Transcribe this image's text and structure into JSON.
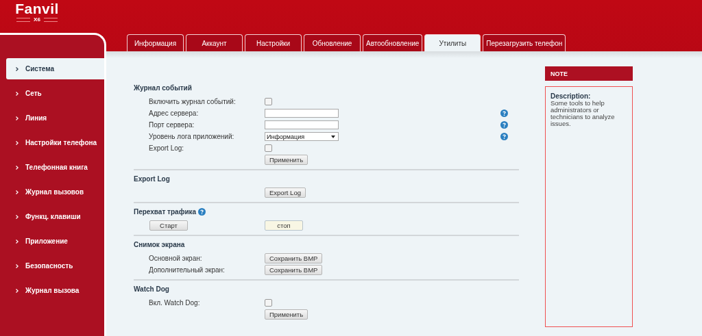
{
  "logo": {
    "brand": "Fanvil",
    "model": "X6"
  },
  "tabs": [
    {
      "label": "Информация",
      "selected": false
    },
    {
      "label": "Аккаунт",
      "selected": false
    },
    {
      "label": "Настройки",
      "selected": false
    },
    {
      "label": "Обновление",
      "selected": false
    },
    {
      "label": "Автообновление",
      "selected": false
    },
    {
      "label": "Утилиты",
      "selected": true
    },
    {
      "label": "Перезагрузить телефон",
      "selected": false
    }
  ],
  "sidebar": {
    "items": [
      {
        "label": "Система",
        "selected": true
      },
      {
        "label": "Сеть",
        "selected": false
      },
      {
        "label": "Линия",
        "selected": false
      },
      {
        "label": "Настройки телефона",
        "selected": false
      },
      {
        "label": "Телефонная книга",
        "selected": false
      },
      {
        "label": "Журнал вызовов",
        "selected": false
      },
      {
        "label": "Функц. клавиши",
        "selected": false
      },
      {
        "label": "Приложение",
        "selected": false
      },
      {
        "label": "Безопасность",
        "selected": false
      },
      {
        "label": "Журнал вызова",
        "selected": false
      }
    ]
  },
  "sections": [
    {
      "title": "Журнал событий",
      "help": false,
      "rows": [
        {
          "kind": "checkbox",
          "label": "Включить журнал событий:",
          "checked": false,
          "help": false
        },
        {
          "kind": "input",
          "label": "Адрес сервера:",
          "help": true
        },
        {
          "kind": "input",
          "label": "Порт сервера:",
          "help": true
        },
        {
          "kind": "select",
          "label": "Уровень лога приложений:",
          "value": "Информация",
          "help": true
        },
        {
          "kind": "checkbox",
          "label": "Export Log:",
          "checked": false,
          "help": false
        },
        {
          "kind": "button",
          "button": "Применить",
          "help": false
        }
      ]
    },
    {
      "title": "Export Log",
      "help": false,
      "rows": [
        {
          "kind": "button",
          "button": "Export Log",
          "help": false
        }
      ]
    },
    {
      "title": "Перехват трафика",
      "help": true,
      "rows": [
        {
          "kind": "start-stop",
          "start": "Старт",
          "stop": "стоп"
        }
      ]
    },
    {
      "title": "Снимок экрана",
      "help": false,
      "rows": [
        {
          "kind": "button",
          "label": "Основной экран:",
          "button": "Сохранить BMP",
          "help": false
        },
        {
          "kind": "button",
          "label": "Дополнительный экран:",
          "button": "Сохранить BMP",
          "help": false
        }
      ]
    },
    {
      "title": "Watch Dog",
      "help": false,
      "rows": [
        {
          "kind": "checkbox",
          "label": "Вкл. Watch Dog:",
          "checked": false,
          "help": false
        },
        {
          "kind": "button",
          "button": "Применить",
          "help": false
        }
      ]
    }
  ],
  "note": {
    "title": "NOTE",
    "heading": "Description:",
    "text": "Some tools to help administrators or technicians to analyze issues."
  }
}
